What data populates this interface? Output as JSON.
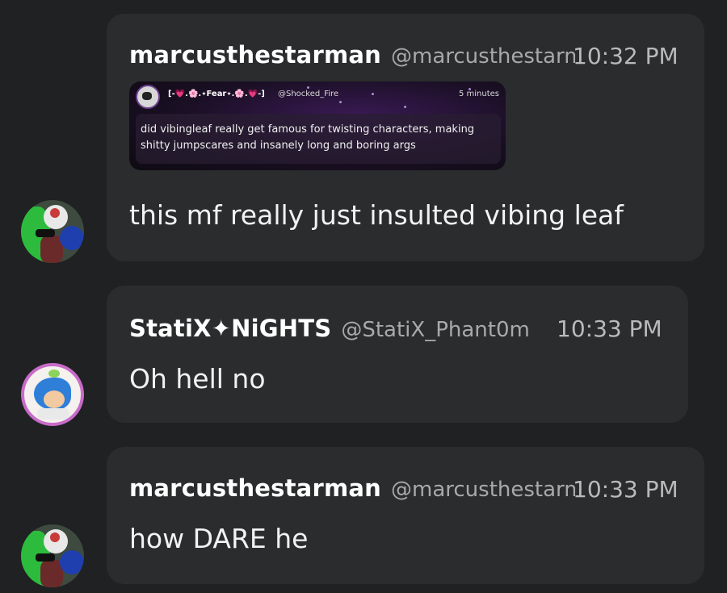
{
  "messages": [
    {
      "author": "marcusthestarman",
      "handle": "@marcusthestarman",
      "time": "10:32 PM",
      "text": "this mf really just insulted vibing leaf",
      "avatar_icon": "marcus-avatar",
      "embed": {
        "author": "[-💗.🌸.⋆Fear⋆.🌸.💗-]",
        "handle": "@Shocked_Fire",
        "time": "5 minutes",
        "text": "did vibingleaf really get famous for twisting characters, making shitty jumpscares and insanely long and boring args"
      }
    },
    {
      "author": "StatiX✦NiGHTS",
      "handle": "@StatiX_Phant0m",
      "time": "10:33 PM",
      "text": "Oh hell no",
      "avatar_icon": "statix-avatar"
    },
    {
      "author": "marcusthestarman",
      "handle": "@marcusthestarman",
      "time": "10:33 PM",
      "text": "how DARE he",
      "avatar_icon": "marcus-avatar"
    }
  ],
  "colors": {
    "background": "#1f2122",
    "bubble": "#2a2c2d",
    "name": "#ffffff",
    "handle": "#a7aaab",
    "timestamp": "#b8bbbc"
  }
}
